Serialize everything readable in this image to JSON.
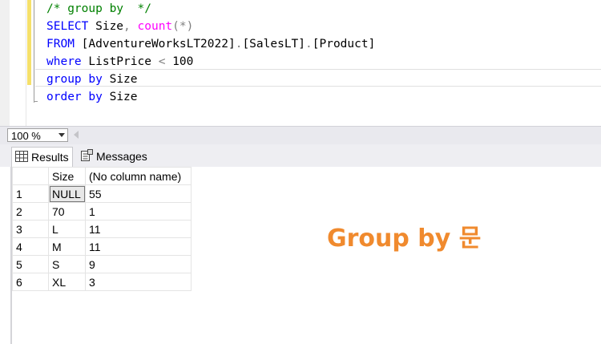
{
  "editor": {
    "lines": [
      {
        "parts": [
          {
            "t": "/* group by  */",
            "c": "cm"
          }
        ]
      },
      {
        "parts": [
          {
            "t": "SELECT",
            "c": "kw"
          },
          {
            "t": " Size",
            "c": ""
          },
          {
            "t": ",",
            "c": "op"
          },
          {
            "t": " ",
            "c": ""
          },
          {
            "t": "count",
            "c": "fn"
          },
          {
            "t": "(*)",
            "c": "op"
          }
        ]
      },
      {
        "parts": [
          {
            "t": "FROM",
            "c": "kw"
          },
          {
            "t": " ",
            "c": ""
          },
          {
            "t": "[AdventureWorksLT2022]",
            "c": ""
          },
          {
            "t": ".",
            "c": "op"
          },
          {
            "t": "[SalesLT]",
            "c": ""
          },
          {
            "t": ".",
            "c": "op"
          },
          {
            "t": "[Product]",
            "c": ""
          }
        ]
      },
      {
        "parts": [
          {
            "t": "where",
            "c": "kw"
          },
          {
            "t": " ListPrice ",
            "c": ""
          },
          {
            "t": "<",
            "c": "op"
          },
          {
            "t": " 100",
            "c": ""
          }
        ]
      },
      {
        "parts": [
          {
            "t": "group",
            "c": "kw"
          },
          {
            "t": " ",
            "c": ""
          },
          {
            "t": "by",
            "c": "kw"
          },
          {
            "t": " Size",
            "c": ""
          }
        ]
      },
      {
        "parts": [
          {
            "t": "order",
            "c": "kw"
          },
          {
            "t": " ",
            "c": ""
          },
          {
            "t": "by",
            "c": "kw"
          },
          {
            "t": " Size",
            "c": ""
          }
        ]
      }
    ]
  },
  "zoom": {
    "value": "100 %"
  },
  "tabs": {
    "results": "Results",
    "messages": "Messages"
  },
  "grid": {
    "headers": [
      "Size",
      "(No column name)"
    ],
    "rows": [
      [
        "1",
        "NULL",
        "55"
      ],
      [
        "2",
        "70",
        "1"
      ],
      [
        "3",
        "L",
        "11"
      ],
      [
        "4",
        "M",
        "11"
      ],
      [
        "5",
        "S",
        "9"
      ],
      [
        "6",
        "XL",
        "3"
      ]
    ]
  },
  "overlay": {
    "title": "Group by 문"
  },
  "colors": {
    "keyword": "#0000ff",
    "function": "#ff00ff",
    "comment": "#008000",
    "accent": "#f08a2e"
  }
}
